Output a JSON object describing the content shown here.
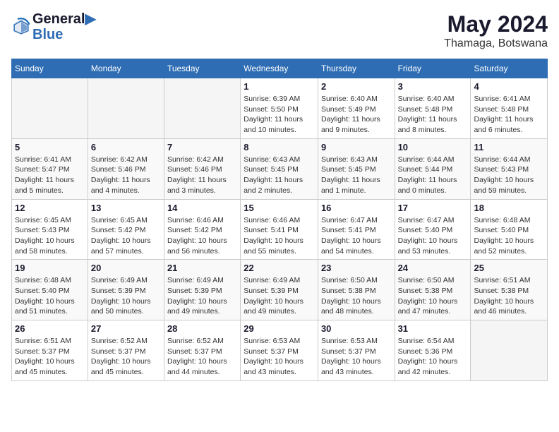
{
  "header": {
    "logo_line1": "General",
    "logo_line2": "Blue",
    "month": "May 2024",
    "location": "Thamaga, Botswana"
  },
  "days_of_week": [
    "Sunday",
    "Monday",
    "Tuesday",
    "Wednesday",
    "Thursday",
    "Friday",
    "Saturday"
  ],
  "weeks": [
    [
      {
        "day": "",
        "sunrise": "",
        "sunset": "",
        "daylight": ""
      },
      {
        "day": "",
        "sunrise": "",
        "sunset": "",
        "daylight": ""
      },
      {
        "day": "",
        "sunrise": "",
        "sunset": "",
        "daylight": ""
      },
      {
        "day": "1",
        "sunrise": "Sunrise: 6:39 AM",
        "sunset": "Sunset: 5:50 PM",
        "daylight": "Daylight: 11 hours and 10 minutes."
      },
      {
        "day": "2",
        "sunrise": "Sunrise: 6:40 AM",
        "sunset": "Sunset: 5:49 PM",
        "daylight": "Daylight: 11 hours and 9 minutes."
      },
      {
        "day": "3",
        "sunrise": "Sunrise: 6:40 AM",
        "sunset": "Sunset: 5:48 PM",
        "daylight": "Daylight: 11 hours and 8 minutes."
      },
      {
        "day": "4",
        "sunrise": "Sunrise: 6:41 AM",
        "sunset": "Sunset: 5:48 PM",
        "daylight": "Daylight: 11 hours and 6 minutes."
      }
    ],
    [
      {
        "day": "5",
        "sunrise": "Sunrise: 6:41 AM",
        "sunset": "Sunset: 5:47 PM",
        "daylight": "Daylight: 11 hours and 5 minutes."
      },
      {
        "day": "6",
        "sunrise": "Sunrise: 6:42 AM",
        "sunset": "Sunset: 5:46 PM",
        "daylight": "Daylight: 11 hours and 4 minutes."
      },
      {
        "day": "7",
        "sunrise": "Sunrise: 6:42 AM",
        "sunset": "Sunset: 5:46 PM",
        "daylight": "Daylight: 11 hours and 3 minutes."
      },
      {
        "day": "8",
        "sunrise": "Sunrise: 6:43 AM",
        "sunset": "Sunset: 5:45 PM",
        "daylight": "Daylight: 11 hours and 2 minutes."
      },
      {
        "day": "9",
        "sunrise": "Sunrise: 6:43 AM",
        "sunset": "Sunset: 5:45 PM",
        "daylight": "Daylight: 11 hours and 1 minute."
      },
      {
        "day": "10",
        "sunrise": "Sunrise: 6:44 AM",
        "sunset": "Sunset: 5:44 PM",
        "daylight": "Daylight: 11 hours and 0 minutes."
      },
      {
        "day": "11",
        "sunrise": "Sunrise: 6:44 AM",
        "sunset": "Sunset: 5:43 PM",
        "daylight": "Daylight: 10 hours and 59 minutes."
      }
    ],
    [
      {
        "day": "12",
        "sunrise": "Sunrise: 6:45 AM",
        "sunset": "Sunset: 5:43 PM",
        "daylight": "Daylight: 10 hours and 58 minutes."
      },
      {
        "day": "13",
        "sunrise": "Sunrise: 6:45 AM",
        "sunset": "Sunset: 5:42 PM",
        "daylight": "Daylight: 10 hours and 57 minutes."
      },
      {
        "day": "14",
        "sunrise": "Sunrise: 6:46 AM",
        "sunset": "Sunset: 5:42 PM",
        "daylight": "Daylight: 10 hours and 56 minutes."
      },
      {
        "day": "15",
        "sunrise": "Sunrise: 6:46 AM",
        "sunset": "Sunset: 5:41 PM",
        "daylight": "Daylight: 10 hours and 55 minutes."
      },
      {
        "day": "16",
        "sunrise": "Sunrise: 6:47 AM",
        "sunset": "Sunset: 5:41 PM",
        "daylight": "Daylight: 10 hours and 54 minutes."
      },
      {
        "day": "17",
        "sunrise": "Sunrise: 6:47 AM",
        "sunset": "Sunset: 5:40 PM",
        "daylight": "Daylight: 10 hours and 53 minutes."
      },
      {
        "day": "18",
        "sunrise": "Sunrise: 6:48 AM",
        "sunset": "Sunset: 5:40 PM",
        "daylight": "Daylight: 10 hours and 52 minutes."
      }
    ],
    [
      {
        "day": "19",
        "sunrise": "Sunrise: 6:48 AM",
        "sunset": "Sunset: 5:40 PM",
        "daylight": "Daylight: 10 hours and 51 minutes."
      },
      {
        "day": "20",
        "sunrise": "Sunrise: 6:49 AM",
        "sunset": "Sunset: 5:39 PM",
        "daylight": "Daylight: 10 hours and 50 minutes."
      },
      {
        "day": "21",
        "sunrise": "Sunrise: 6:49 AM",
        "sunset": "Sunset: 5:39 PM",
        "daylight": "Daylight: 10 hours and 49 minutes."
      },
      {
        "day": "22",
        "sunrise": "Sunrise: 6:49 AM",
        "sunset": "Sunset: 5:39 PM",
        "daylight": "Daylight: 10 hours and 49 minutes."
      },
      {
        "day": "23",
        "sunrise": "Sunrise: 6:50 AM",
        "sunset": "Sunset: 5:38 PM",
        "daylight": "Daylight: 10 hours and 48 minutes."
      },
      {
        "day": "24",
        "sunrise": "Sunrise: 6:50 AM",
        "sunset": "Sunset: 5:38 PM",
        "daylight": "Daylight: 10 hours and 47 minutes."
      },
      {
        "day": "25",
        "sunrise": "Sunrise: 6:51 AM",
        "sunset": "Sunset: 5:38 PM",
        "daylight": "Daylight: 10 hours and 46 minutes."
      }
    ],
    [
      {
        "day": "26",
        "sunrise": "Sunrise: 6:51 AM",
        "sunset": "Sunset: 5:37 PM",
        "daylight": "Daylight: 10 hours and 45 minutes."
      },
      {
        "day": "27",
        "sunrise": "Sunrise: 6:52 AM",
        "sunset": "Sunset: 5:37 PM",
        "daylight": "Daylight: 10 hours and 45 minutes."
      },
      {
        "day": "28",
        "sunrise": "Sunrise: 6:52 AM",
        "sunset": "Sunset: 5:37 PM",
        "daylight": "Daylight: 10 hours and 44 minutes."
      },
      {
        "day": "29",
        "sunrise": "Sunrise: 6:53 AM",
        "sunset": "Sunset: 5:37 PM",
        "daylight": "Daylight: 10 hours and 43 minutes."
      },
      {
        "day": "30",
        "sunrise": "Sunrise: 6:53 AM",
        "sunset": "Sunset: 5:37 PM",
        "daylight": "Daylight: 10 hours and 43 minutes."
      },
      {
        "day": "31",
        "sunrise": "Sunrise: 6:54 AM",
        "sunset": "Sunset: 5:36 PM",
        "daylight": "Daylight: 10 hours and 42 minutes."
      },
      {
        "day": "",
        "sunrise": "",
        "sunset": "",
        "daylight": ""
      }
    ]
  ]
}
